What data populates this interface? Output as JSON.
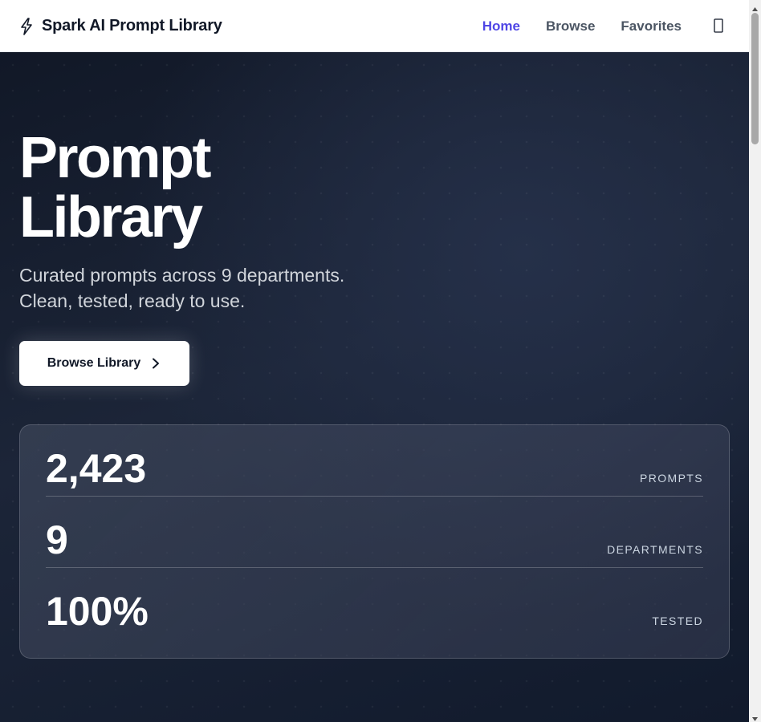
{
  "header": {
    "brand_icon": "lightning-bolt-icon",
    "brand_title": "Spark AI Prompt Library",
    "nav": [
      {
        "label": "Home",
        "active": true
      },
      {
        "label": "Browse",
        "active": false
      },
      {
        "label": "Favorites",
        "active": false
      }
    ],
    "theme_toggle_icon": "theme-toggle-icon",
    "active_color": "#4f46e5"
  },
  "hero": {
    "title_line1": "Prompt",
    "title_line2": "Library",
    "subtitle_line1": "Curated prompts across 9 departments.",
    "subtitle_line2": "Clean, tested, ready to use.",
    "cta_label": "Browse Library",
    "cta_icon": "chevron-right-icon"
  },
  "stats": [
    {
      "value": "2,423",
      "label": "PROMPTS"
    },
    {
      "value": "9",
      "label": "DEPARTMENTS"
    },
    {
      "value": "100%",
      "label": "TESTED"
    }
  ]
}
